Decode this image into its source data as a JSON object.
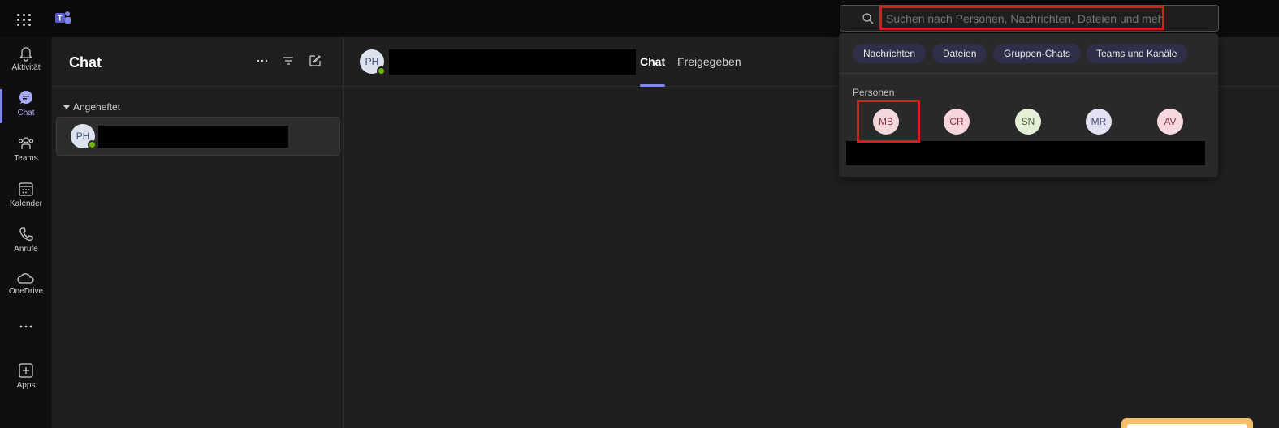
{
  "search": {
    "placeholder": "Suchen nach Personen, Nachrichten, Dateien und mehr"
  },
  "rail": {
    "items": [
      {
        "label": "Aktivität",
        "icon": "bell-icon"
      },
      {
        "label": "Chat",
        "icon": "chat-icon"
      },
      {
        "label": "Teams",
        "icon": "teams-icon"
      },
      {
        "label": "Kalender",
        "icon": "calendar-icon"
      },
      {
        "label": "Anrufe",
        "icon": "phone-icon"
      },
      {
        "label": "OneDrive",
        "icon": "cloud-icon"
      },
      {
        "label": "",
        "icon": "more-icon"
      },
      {
        "label": "Apps",
        "icon": "add-app-icon"
      }
    ]
  },
  "list": {
    "title": "Chat",
    "pinned_label": "Angeheftet",
    "chats": [
      {
        "initials": "PH"
      }
    ]
  },
  "main": {
    "contact_initials": "PH",
    "tabs": [
      {
        "label": "Chat",
        "active": true
      },
      {
        "label": "Freigegeben",
        "active": false
      }
    ]
  },
  "dropdown": {
    "filters": [
      "Nachrichten",
      "Dateien",
      "Gruppen-Chats",
      "Teams und Kanäle"
    ],
    "people_label": "Personen",
    "people": [
      {
        "initials": "MB",
        "bg": "#f4d7da",
        "fg": "#8a3a44"
      },
      {
        "initials": "CR",
        "bg": "#f7d6db",
        "fg": "#8a3040"
      },
      {
        "initials": "SN",
        "bg": "#e4efd8",
        "fg": "#4a6630"
      },
      {
        "initials": "MR",
        "bg": "#e1e1f2",
        "fg": "#4a4a7a"
      },
      {
        "initials": "AV",
        "bg": "#f6d8de",
        "fg": "#8a3446"
      }
    ]
  },
  "colors": {
    "accent": "#7f85f5",
    "highlight": "#d41f1f",
    "presence": "#6bb700"
  }
}
